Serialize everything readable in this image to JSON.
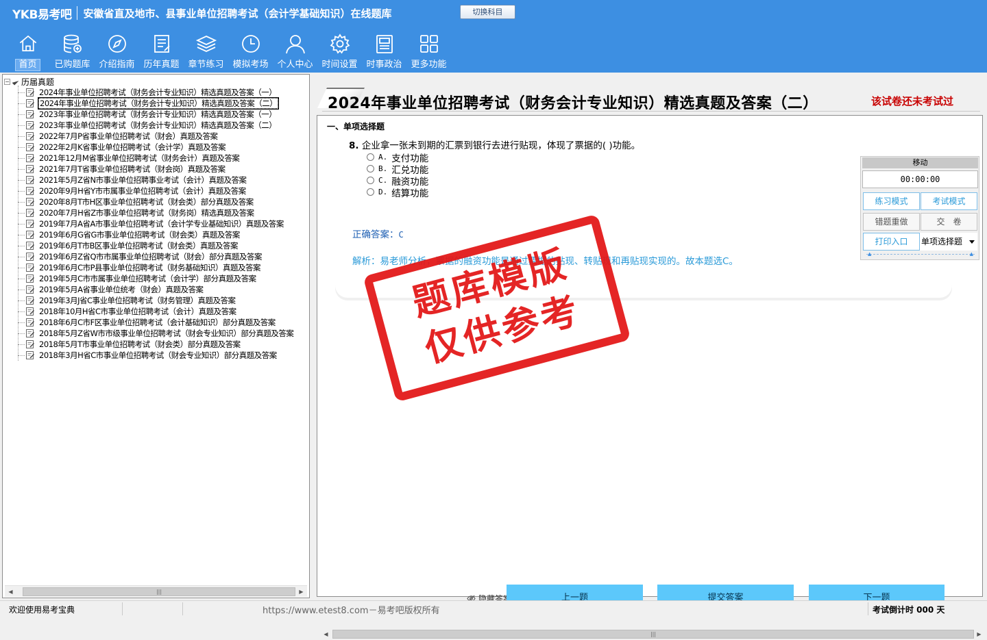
{
  "header": {
    "logo": "YKB易考吧",
    "title": "安徽省直及地市、县事业单位招聘考试（会计学基础知识）在线题库",
    "switch_label": "切换科目",
    "nav": [
      {
        "label": "首页",
        "icon": "home-icon"
      },
      {
        "label": "已购题库",
        "icon": "database-icon"
      },
      {
        "label": "介绍指南",
        "icon": "compass-icon"
      },
      {
        "label": "历年真题",
        "icon": "document-list-icon"
      },
      {
        "label": "章节练习",
        "icon": "layers-icon"
      },
      {
        "label": "模拟考场",
        "icon": "clock-icon"
      },
      {
        "label": "个人中心",
        "icon": "user-icon"
      },
      {
        "label": "时间设置",
        "icon": "gear-icon"
      },
      {
        "label": "时事政治",
        "icon": "news-icon"
      },
      {
        "label": "更多功能",
        "icon": "grid-icon"
      }
    ]
  },
  "tree": {
    "root_label": "历届真题",
    "items": [
      "2024年事业单位招聘考试（财务会计专业知识）精选真题及答案（一）",
      "2024年事业单位招聘考试（财务会计专业知识）精选真题及答案（二）",
      "2023年事业单位招聘考试（财务会计专业知识）精选真题及答案（一）",
      "2023年事业单位招聘考试（财务会计专业知识）精选真题及答案（二）",
      "2022年7月P省事业单位招聘考试（财会）真题及答案",
      "2022年2月K省事业单位招聘考试（会计学）真题及答案",
      "2021年12月M省事业单位招聘考试（财务会计）真题及答案",
      "2021年7月T省事业单位招聘考试（财会岗）真题及答案",
      "2021年5月Z省N市事业单位招聘事业考试（会计）真题及答案",
      "2020年9月H省Y市市属事业单位招聘考试（会计）真题及答案",
      "2020年8月T市H区事业单位招聘考试（财会类）部分真题及答案",
      "2020年7月H省Z市事业单位招聘考试（财务岗）精选真题及答案",
      "2019年7月A省A市事业单位招聘考试（会计学专业基础知识）真题及答案",
      "2019年6月G省G市事业单位招聘考试（财会类）真题及答案",
      "2019年6月T市B区事业单位招聘考试（财会类）真题及答案",
      "2019年6月Z省Q市市属事业单位招聘考试（财会）部分真题及答案",
      "2019年6月C市P县事业单位招聘考试（财务基础知识）真题及答案",
      "2019年5月C市市属事业单位招聘考试（会计学）部分真题及答案",
      "2019年5月A省事业单位统考（财会）真题及答案",
      "2019年3月J省C事业单位招聘考试（财务管理）真题及答案",
      "2018年10月H省C市事业单位招聘考试（会计）真题及答案",
      "2018年6月C市F区事业单位招聘考试（会计基础知识）部分真题及答案",
      "2018年5月Z省W市市级事业单位招聘考试（财会专业知识）部分真题及答案",
      "2018年5月T市事业单位招聘考试（财会类）部分真题及答案",
      "2018年3月H省C市事业单位招聘考试（财会专业知识）部分真题及答案"
    ],
    "selected_index": 1
  },
  "paper": {
    "title": "2024年事业单位招聘考试（财务会计专业知识）精选真题及答案（二）",
    "status": "该试卷还未考试过",
    "section": "一、单项选择题"
  },
  "question": {
    "number": "8.",
    "text": "企业拿一张未到期的汇票到银行去进行贴现，体现了票据的(  )功能。",
    "options": [
      {
        "letter": "A.",
        "text": "支付功能"
      },
      {
        "letter": "B.",
        "text": "汇兑功能"
      },
      {
        "letter": "C.",
        "text": "融资功能"
      },
      {
        "letter": "D.",
        "text": "结算功能"
      }
    ],
    "answer_label": "正确答案：",
    "answer_value": "C",
    "analysis": "解析：易老师分析，票据的融资功能是通过票据的贴现、转贴现和再贴现实现的。故本题选C。"
  },
  "control_panel": {
    "move_label": "移动",
    "timer": "00:00:00",
    "practice_mode": "练习模式",
    "exam_mode": "考试模式",
    "wrong_redo": "错题重做",
    "submit_paper": "交　卷",
    "print_entry": "打印入口",
    "question_type": "单项选择题"
  },
  "stamp": {
    "line1": "题库模版",
    "line2": "仅供参考"
  },
  "footer_buttons": {
    "hide_answer": "隐藏答案",
    "prev": "上一题",
    "submit": "提交答案",
    "next": "下一题"
  },
  "statusbar": {
    "welcome": "欢迎使用易考宝典",
    "copyright": "https://www.etest8.com－易考吧版权所有",
    "countdown": "考试倒计时 000 天"
  }
}
